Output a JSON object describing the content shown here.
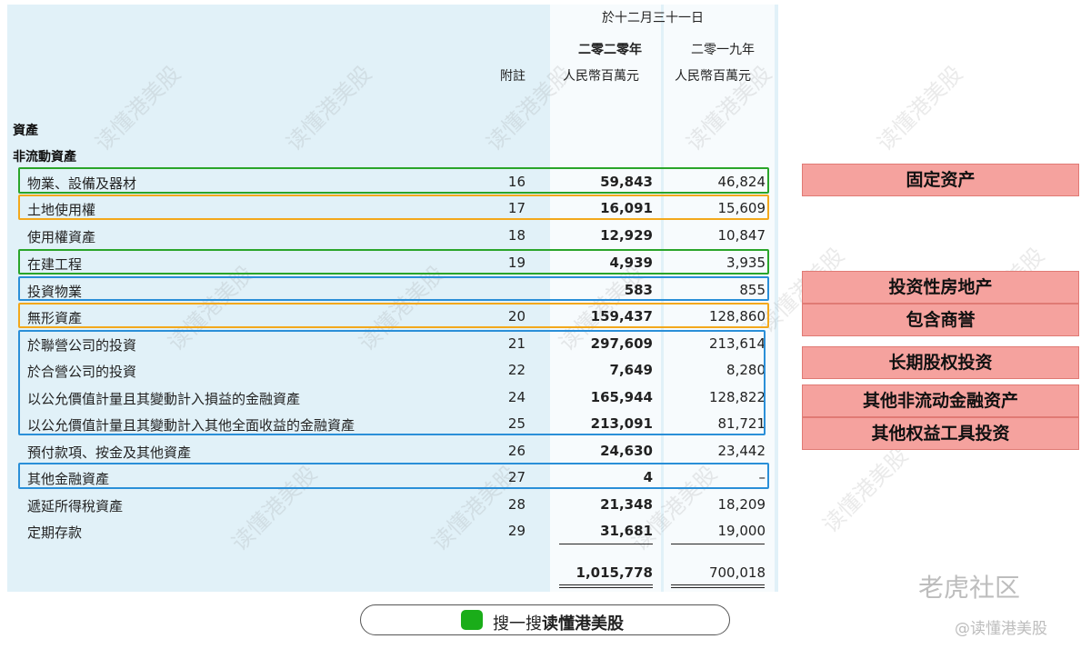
{
  "header": {
    "period": "於十二月三十一日",
    "year_2020": "二零二零年",
    "year_2019": "二零一九年",
    "currency_2020": "人民幣百萬元",
    "currency_2019": "人民幣百萬元",
    "note_col": "附註"
  },
  "sections": {
    "assets": "資產",
    "non_current": "非流動資產"
  },
  "rows": [
    {
      "label": "物業、設備及器材",
      "note": "16",
      "v2020": "59,843",
      "v2019": "46,824"
    },
    {
      "label": "土地使用權",
      "note": "17",
      "v2020": "16,091",
      "v2019": "15,609"
    },
    {
      "label": "使用權資產",
      "note": "18",
      "v2020": "12,929",
      "v2019": "10,847"
    },
    {
      "label": "在建工程",
      "note": "19",
      "v2020": "4,939",
      "v2019": "3,935"
    },
    {
      "label": "投資物業",
      "note": "",
      "v2020": "583",
      "v2019": "855"
    },
    {
      "label": "無形資產",
      "note": "20",
      "v2020": "159,437",
      "v2019": "128,860"
    },
    {
      "label": "於聯營公司的投資",
      "note": "21",
      "v2020": "297,609",
      "v2019": "213,614"
    },
    {
      "label": "於合營公司的投資",
      "note": "22",
      "v2020": "7,649",
      "v2019": "8,280"
    },
    {
      "label": "以公允價值計量且其變動計入損益的金融資產",
      "note": "24",
      "v2020": "165,944",
      "v2019": "128,822"
    },
    {
      "label": "以公允價值計量且其變動計入其他全面收益的金融資產",
      "note": "25",
      "v2020": "213,091",
      "v2019": "81,721"
    },
    {
      "label": "預付款項、按金及其他資產",
      "note": "26",
      "v2020": "24,630",
      "v2019": "23,442"
    },
    {
      "label": "其他金融資產",
      "note": "27",
      "v2020": "4",
      "v2019": "–"
    },
    {
      "label": "遞延所得稅資產",
      "note": "28",
      "v2020": "21,348",
      "v2019": "18,209"
    },
    {
      "label": "定期存款",
      "note": "29",
      "v2020": "31,681",
      "v2019": "19,000"
    }
  ],
  "totals": {
    "v2020": "1,015,778",
    "v2019": "700,018"
  },
  "tags": [
    "固定资产",
    "投资性房地产",
    "包含商誉",
    "长期股权投资",
    "其他非流动金融资产",
    "其他权益工具投资"
  ],
  "colors": {
    "green_box": "#2aa52a",
    "orange_box": "#f3a81c",
    "blue_box": "#2a8fd8",
    "tag_bg": "#f5a29e"
  },
  "search": {
    "prefix": "搜一搜",
    "keyword": "读懂港美股"
  },
  "watermark": "读懂港美股",
  "footer": {
    "logo": "老虎社区",
    "handle": "@读懂港美股"
  }
}
